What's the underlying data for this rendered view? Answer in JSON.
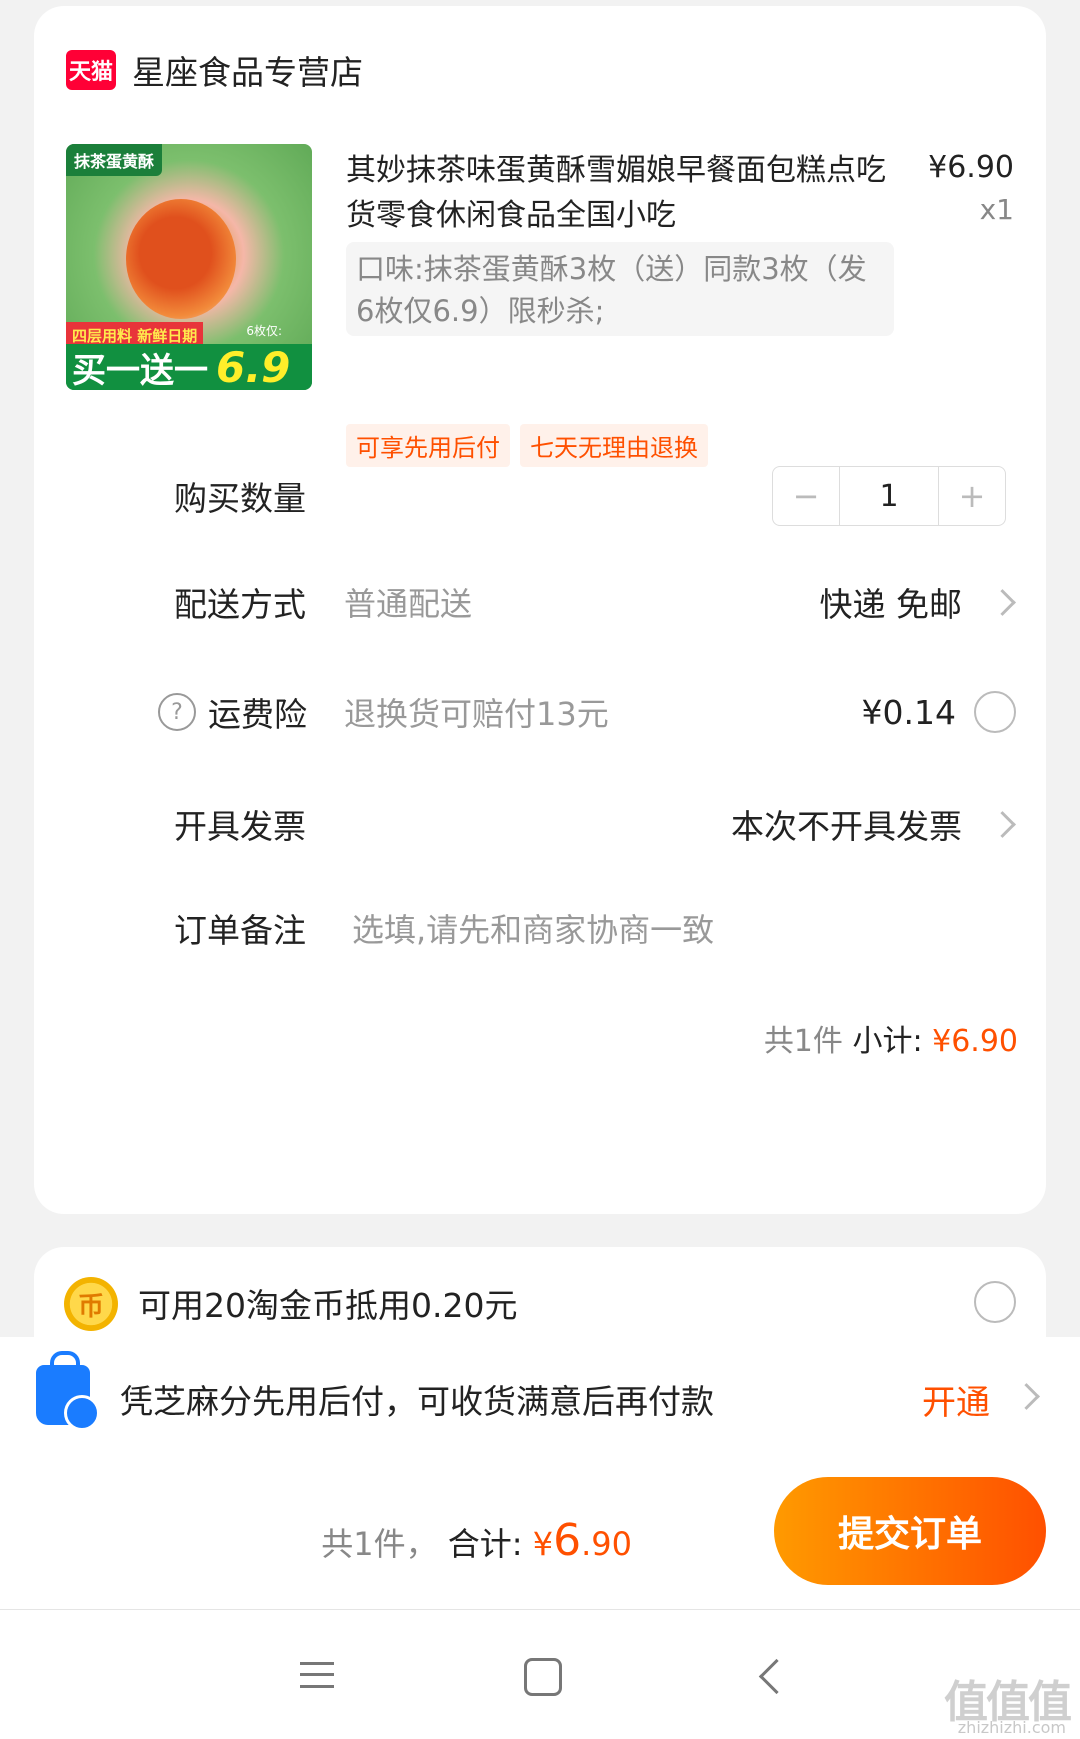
{
  "store": {
    "badge": "天猫",
    "name": "星座食品专营店"
  },
  "product": {
    "thumb_tag": "抹茶蛋黄酥",
    "thumb_strip": "四层用料 新鲜日期",
    "thumb_small": "6枚仅:",
    "thumb_promo": "买一送一",
    "thumb_price": "6.9",
    "title": "其妙抹茶味蛋黄酥雪媚娘早餐面包糕点吃货零食休闲食品全国小吃",
    "unit_price": "¥6.90",
    "qty": "x1",
    "spec": "口味:抹茶蛋黄酥3枚（送）同款3枚（发6枚仅6.9）限秒杀;",
    "badges": [
      "可享先用后付",
      "七天无理由退换"
    ]
  },
  "rows": {
    "quantity": {
      "label": "购买数量",
      "minus": "−",
      "value": "1",
      "plus": "+"
    },
    "delivery": {
      "label": "配送方式",
      "sub": "普通配送",
      "right": "快递 免邮"
    },
    "insurance": {
      "icon": "?",
      "label": "运费险",
      "sub": "退换货可赔付13元",
      "right": "¥0.14"
    },
    "invoice": {
      "label": "开具发票",
      "right": "本次不开具发票"
    },
    "note": {
      "label": "订单备注",
      "placeholder": "选填,请先和商家协商一致"
    }
  },
  "subtotal": {
    "count": "共1件",
    "label": "小计:",
    "amount": "¥6.90"
  },
  "coins": {
    "icon": "币",
    "text": "可用20淘金币抵用0.20元"
  },
  "credit": {
    "text": "凭芝麻分先用后付，可收货满意后再付款",
    "action": "开通"
  },
  "footer": {
    "count": "共1件，",
    "label": "合计:",
    "currency": "¥",
    "amount_int": "6",
    "amount_dec": ".90",
    "submit": "提交订单"
  },
  "watermark": {
    "main": "值值值",
    "sub": "zhizhizhi.com"
  },
  "colors": {
    "accent": "#ff5000",
    "tmall": "#ff0036"
  }
}
